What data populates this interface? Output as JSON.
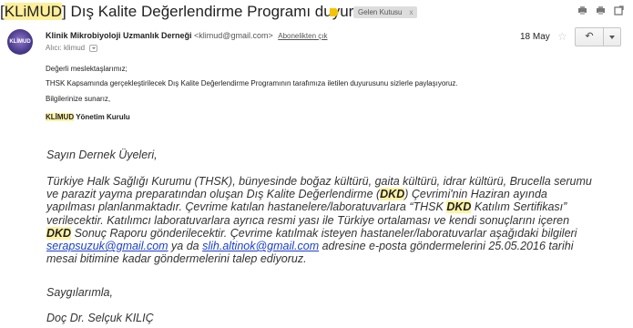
{
  "subject": {
    "tag": "KLiMUD",
    "rest": " Dış Kalite Değerlendirme Programı duyurusu",
    "inbox_label": "Gelen Kutusu",
    "inbox_close": "x"
  },
  "sender": {
    "name": "Klinik Mikrobiyoloji Uzmanlık Derneği",
    "email": "<klimud@gmail.com>",
    "unsubscribe": "Abonelikten çık",
    "to_prefix": "Alıcı:",
    "to": "klimud",
    "date": "18 May",
    "avatar_text": "KLİMUD"
  },
  "intro": {
    "greeting": "Değerli meslektaşlarımız;",
    "line1": "THSK Kapsamında gerçekleştirilecek Dış Kalite Değerlendirme Programının tarafımıza iletilen duyurusunu sizlerle paylaşıyoruz.",
    "line2": "Bilgilerinize sunarız,",
    "sig_tag": "KLİMUD",
    "sig_rest": " Yönetim Kurulu"
  },
  "letter": {
    "salutation": "Sayın Dernek Üyeleri,",
    "p1": "Türkiye Halk Sağlığı Kurumu (THSK), bünyesinde boğaz kültürü, gaita kültürü, idrar kültürü, Brucella serumu ve parazit yayma preparatından oluşan Dış Kalite Değerlendirme (",
    "dkd": "DKD",
    "p2": ") Çevrimi'nin Haziran ayında yapılması planlanmaktadır. Çevrime katılan hastanelere/laboratuvarlara “THSK ",
    "p3": " Katılım Sertifikası” verilecektir. Katılımcı laboratuvarlara ayrıca resmi yası ile Türkiye ortalaması ve kendi sonuçlarını içeren ",
    "p4": " Sonuç Raporu gönderilecektir. Çevrime katılmak isteyen hastaneler/laboratuvarlar aşağıdaki bilgileri ",
    "email1": "serapsuzuk@gmail.com",
    "p5": " ya da ",
    "email2": "slih.altinok@gmail.com",
    "p6": " adresine e-posta göndermelerini 25.05.2016 tarihi mesai bitimine kadar göndermelerini talep ediyoruz.",
    "closing": "Saygılarımla,",
    "signer": "Doç Dr. Selçuk KILIÇ"
  },
  "icons": [
    "print-icon",
    "print-all-icon",
    "popout-icon",
    "star-icon",
    "reply-icon",
    "more-dropdown-icon"
  ],
  "colors": {
    "highlight": "#fff3a6",
    "label": "#f4c400",
    "link": "#1a3ecb"
  }
}
